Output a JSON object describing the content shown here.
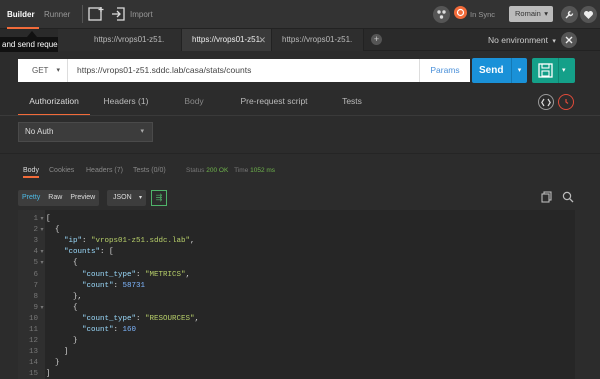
{
  "header": {
    "tabs": [
      {
        "label": "Builder"
      },
      {
        "label": "Runner"
      }
    ],
    "import_label": "Import",
    "sync_label": "In Sync",
    "user_label": "Romain",
    "user_caret": "▾"
  },
  "tooltip": {
    "text": "and send requests"
  },
  "request_tabs": [
    {
      "label": "https://vrops01-z51."
    },
    {
      "label": "https://vrops01-z51."
    },
    {
      "label": "https://vrops01-z51."
    },
    {
      "label": "https://vrops01-z51."
    }
  ],
  "environment": {
    "label": "No environment",
    "caret": "▾"
  },
  "request": {
    "method": "GET",
    "method_caret": "▾",
    "url": "https://vrops01-z51.sddc.lab/casa/stats/counts",
    "params_label": "Params",
    "send_label": "Send",
    "send_caret": "▾"
  },
  "request_sub_tabs": [
    {
      "label": "Authorization"
    },
    {
      "label": "Headers (1)"
    },
    {
      "label": "Body"
    },
    {
      "label": "Pre-request script"
    },
    {
      "label": "Tests"
    }
  ],
  "auth": {
    "value": "No Auth",
    "caret": "▾"
  },
  "response": {
    "tabs": [
      {
        "label": "Body"
      },
      {
        "label": "Cookies"
      },
      {
        "label": "Headers (7)"
      },
      {
        "label": "Tests (0/0)"
      }
    ],
    "status_label": "Status",
    "status_value": "200 OK",
    "time_label": "Time",
    "time_value": "1052 ms",
    "formats": [
      {
        "label": "Pretty"
      },
      {
        "label": "Raw"
      },
      {
        "label": "Preview"
      }
    ],
    "json_select": "JSON",
    "json_caret": "▾"
  },
  "code_lines": [
    {
      "n": "1",
      "text": "["
    },
    {
      "n": "2",
      "text": "  {"
    },
    {
      "n": "3",
      "key": "\"ip\"",
      "sep": ": ",
      "str": "\"vrops01-z51.sddc.lab\"",
      "tail": ","
    },
    {
      "n": "4",
      "key": "\"counts\"",
      "sep": ": [",
      "str": "",
      "tail": ""
    },
    {
      "n": "5",
      "text": "      {"
    },
    {
      "n": "6",
      "key": "\"count_type\"",
      "sep": ": ",
      "str": "\"METRICS\"",
      "tail": ","
    },
    {
      "n": "7",
      "key": "\"count\"",
      "sep": ": ",
      "num": "58731",
      "tail": ""
    },
    {
      "n": "8",
      "text": "      },"
    },
    {
      "n": "9",
      "text": "      {"
    },
    {
      "n": "10",
      "key": "\"count_type\"",
      "sep": ": ",
      "str": "\"RESOURCES\"",
      "tail": ","
    },
    {
      "n": "11",
      "key": "\"count\"",
      "sep": ": ",
      "num": "160",
      "tail": ""
    },
    {
      "n": "12",
      "text": "      }"
    },
    {
      "n": "13",
      "text": "    ]"
    },
    {
      "n": "14",
      "text": "  }"
    },
    {
      "n": "15",
      "text": "]"
    }
  ]
}
